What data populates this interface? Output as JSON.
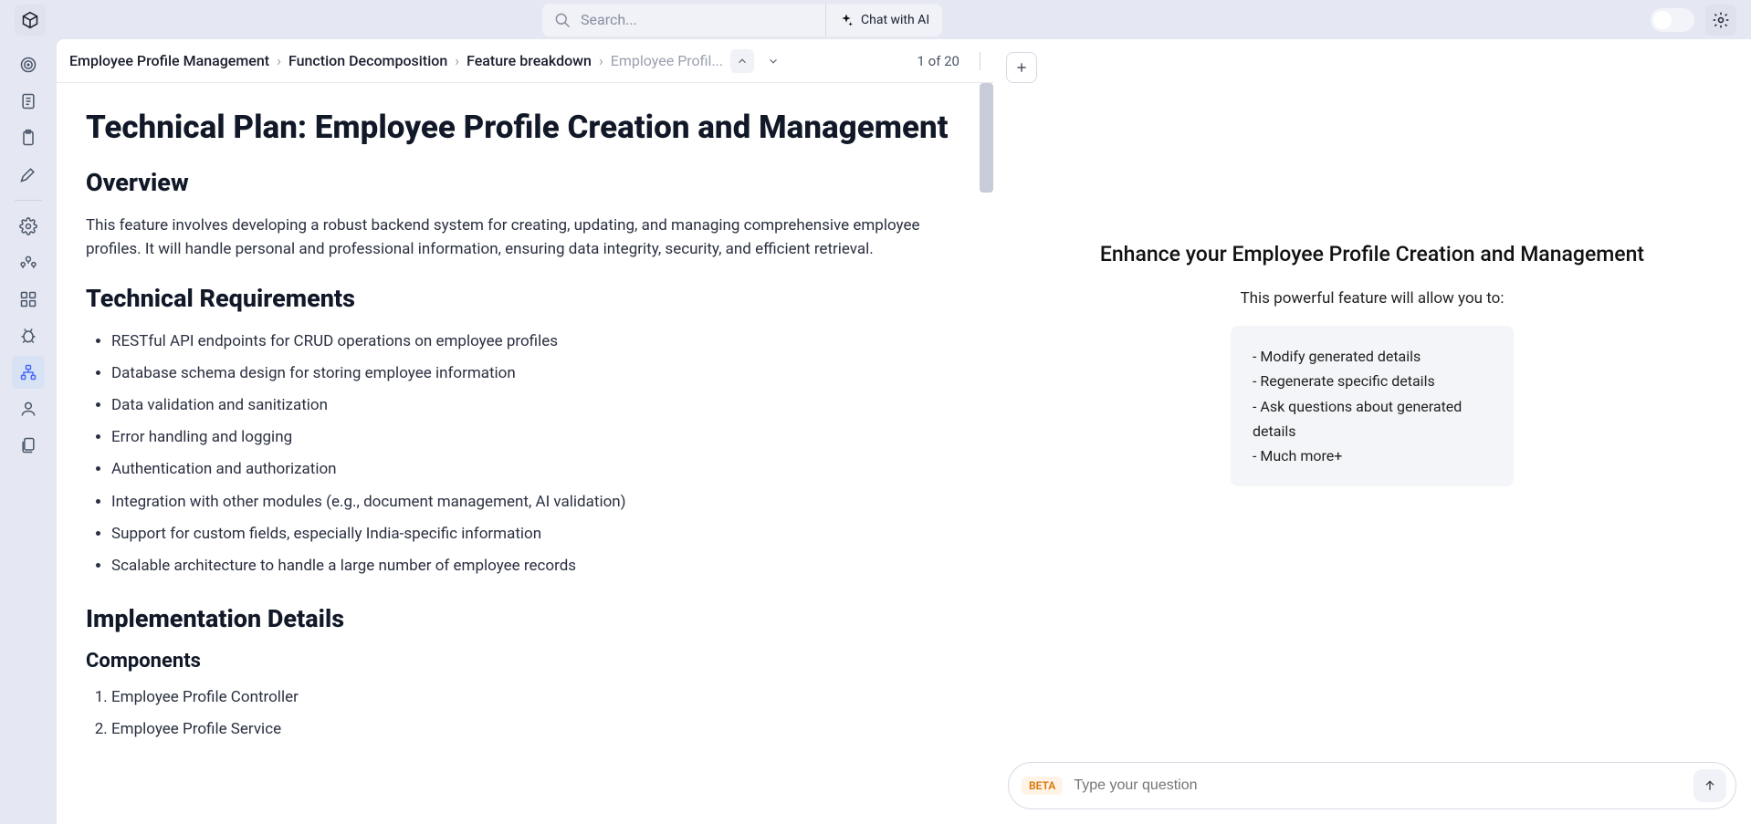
{
  "search": {
    "placeholder": "Search..."
  },
  "chat_ai_label": "Chat with AI",
  "breadcrumb": {
    "items": [
      "Employee Profile Management",
      "Function Decomposition",
      "Feature breakdown"
    ],
    "truncated": "Employee Profil..."
  },
  "page_counter": "1 of 20",
  "doc": {
    "title": "Technical Plan: Employee Profile Creation and Management",
    "overview_heading": "Overview",
    "overview_text": "This feature involves developing a robust backend system for creating, updating, and managing comprehensive employee profiles. It will handle personal and professional information, ensuring data integrity, security, and efficient retrieval.",
    "requirements_heading": "Technical Requirements",
    "requirements": [
      "RESTful API endpoints for CRUD operations on employee profiles",
      "Database schema design for storing employee information",
      "Data validation and sanitization",
      "Error handling and logging",
      "Authentication and authorization",
      "Integration with other modules (e.g., document management, AI validation)",
      "Support for custom fields, especially India-specific information",
      "Scalable architecture to handle a large number of employee records"
    ],
    "implementation_heading": "Implementation Details",
    "components_heading": "Components",
    "components": [
      "Employee Profile Controller",
      "Employee Profile Service"
    ]
  },
  "right": {
    "enhance_title": "Enhance your Employee Profile Creation and Management",
    "enhance_sub": "This powerful feature will allow you to:",
    "features": [
      "- Modify generated details",
      "- Regenerate specific details",
      "- Ask questions about generated details",
      "- Much more+"
    ],
    "beta": "BETA",
    "chat_placeholder": "Type your question"
  }
}
